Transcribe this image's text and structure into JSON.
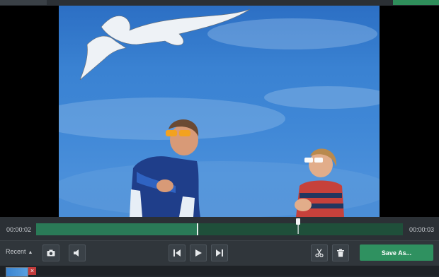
{
  "timeline": {
    "current_time": "00:00:02",
    "end_time": "00:00:03",
    "played_fraction": 0.44,
    "marker_fraction": 0.715
  },
  "controls": {
    "recent_label": "Recent",
    "save_label": "Save As..."
  },
  "icons": {
    "snapshot": "camera-icon",
    "volume": "volume-icon",
    "prev": "skip-back-icon",
    "play": "play-icon",
    "next": "skip-forward-icon",
    "cut": "scissors-icon",
    "delete": "trash-icon",
    "thumb_close": "close-icon"
  },
  "colors": {
    "accent": "#2f9160",
    "track_bg": "#1f4f3a",
    "track_fill": "#2a7a57",
    "panel": "#30363b"
  }
}
